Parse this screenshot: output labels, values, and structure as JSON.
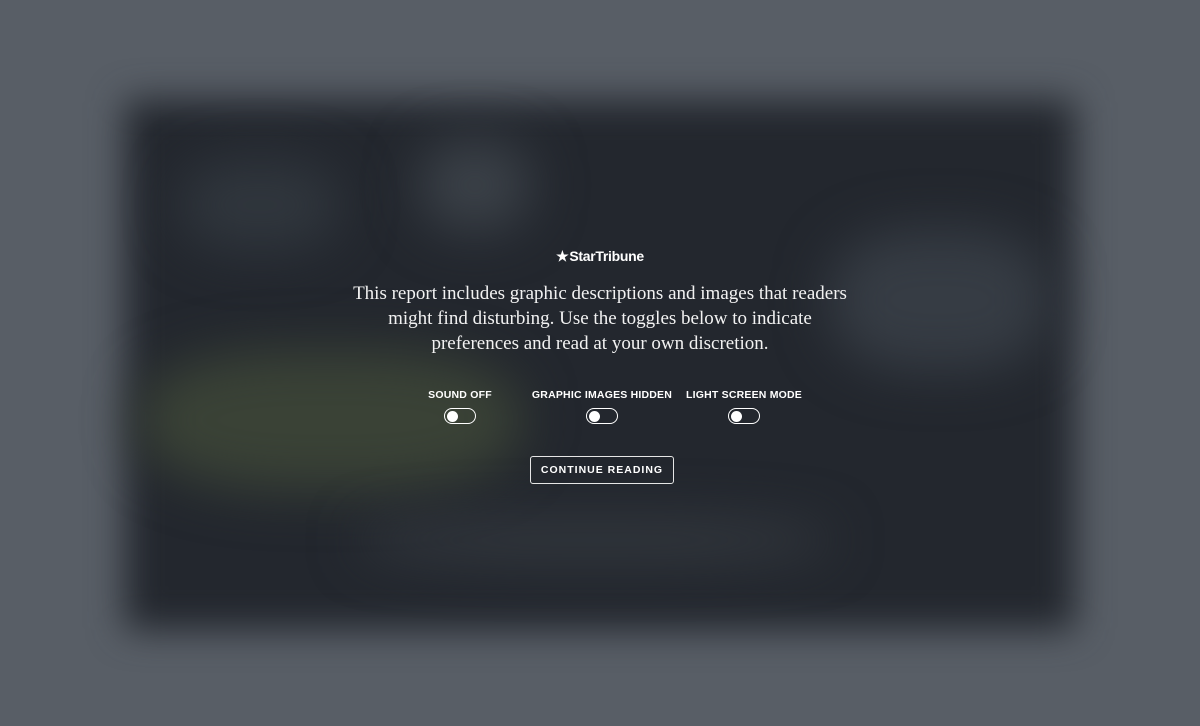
{
  "brand": {
    "star": "★",
    "name": "StarTribune"
  },
  "notice": {
    "text": "This report includes graphic descriptions and images that readers might find disturbing. Use the toggles below to indicate preferences and read at your own discretion."
  },
  "toggles": [
    {
      "label": "SOUND OFF",
      "on": false
    },
    {
      "label": "GRAPHIC IMAGES HIDDEN",
      "on": false
    },
    {
      "label": "LIGHT SCREEN MODE",
      "on": false
    }
  ],
  "continue_button": {
    "label": "CONTINUE READING"
  },
  "colors": {
    "page_background": "#585e66",
    "photo_background": "#23272e",
    "text": "#ffffff"
  }
}
